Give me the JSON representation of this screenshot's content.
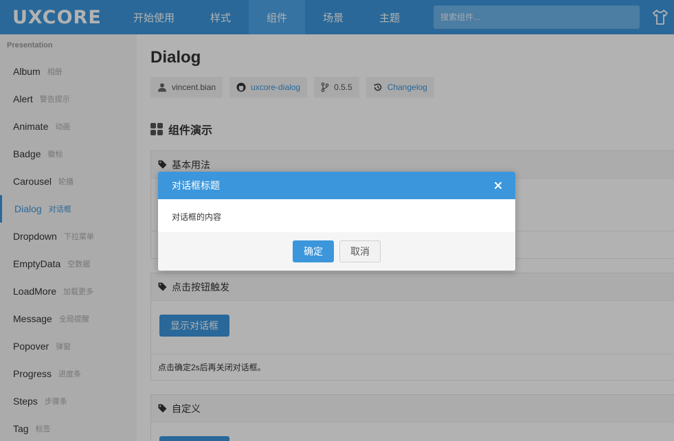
{
  "header": {
    "logo": "UXCore",
    "nav": [
      {
        "label": "开始使用"
      },
      {
        "label": "样式"
      },
      {
        "label": "组件"
      },
      {
        "label": "场景"
      },
      {
        "label": "主题"
      }
    ],
    "active_nav": "组件",
    "search_placeholder": "搜索组件...",
    "theme_icon": "tshirt-icon"
  },
  "sidebar": {
    "group": "Presentation",
    "items": [
      {
        "en": "Album",
        "cn": "相册"
      },
      {
        "en": "Alert",
        "cn": "警告提示"
      },
      {
        "en": "Animate",
        "cn": "动画"
      },
      {
        "en": "Badge",
        "cn": "徽标"
      },
      {
        "en": "Carousel",
        "cn": "轮播"
      },
      {
        "en": "Dialog",
        "cn": "对话框"
      },
      {
        "en": "Dropdown",
        "cn": "下拉菜单"
      },
      {
        "en": "EmptyData",
        "cn": "空数据"
      },
      {
        "en": "LoadMore",
        "cn": "加载更多"
      },
      {
        "en": "Message",
        "cn": "全局提醒"
      },
      {
        "en": "Popover",
        "cn": "弹窗"
      },
      {
        "en": "Progress",
        "cn": "进度条"
      },
      {
        "en": "Steps",
        "cn": "步骤条"
      },
      {
        "en": "Tag",
        "cn": "标签"
      }
    ],
    "active_item": "Dialog"
  },
  "main": {
    "title": "Dialog",
    "meta": {
      "author": "vincent.bian",
      "repo": "uxcore-dialog",
      "version": "0.5.5",
      "changelog": "Changelog"
    },
    "section_title": "组件演示",
    "demos": [
      {
        "title": "基本用法"
      },
      {
        "title": "点击按钮触发",
        "button": "显示对话框",
        "desc": "点击确定2s后再关闭对话框。"
      },
      {
        "title": "自定义"
      }
    ]
  },
  "dialog": {
    "title": "对话框标题",
    "body": "对话框的内容",
    "ok": "确定",
    "cancel": "取消",
    "close_icon": "close-icon"
  },
  "colors": {
    "primary": "#3c96db",
    "sidebar_bg": "#f5f5f5",
    "overlay": "rgba(0,0,0,0.30)"
  }
}
